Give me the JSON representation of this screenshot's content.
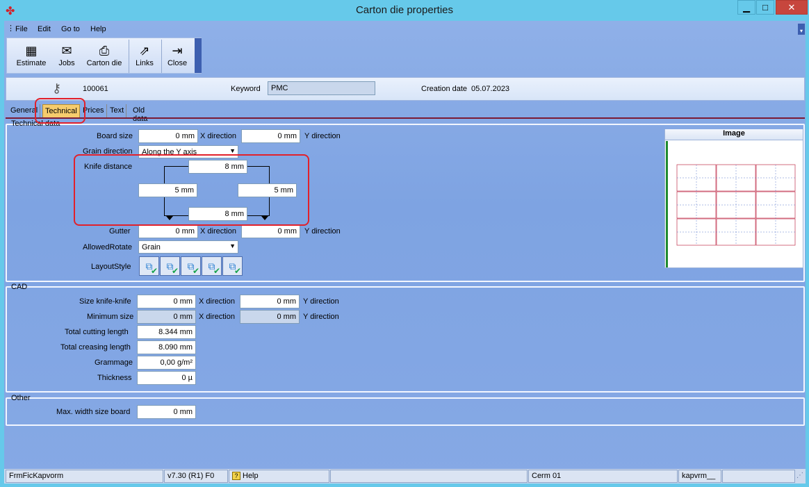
{
  "window": {
    "title": "Carton die properties",
    "minimize_glyph": "▁",
    "maximize_glyph": "□",
    "close_glyph": "✕"
  },
  "menu": {
    "items": [
      "File",
      "Edit",
      "Go to",
      "Help"
    ]
  },
  "toolbar": {
    "estimate": "Estimate",
    "jobs": "Jobs",
    "carton_die": "Carton die",
    "links": "Links",
    "close": "Close"
  },
  "header": {
    "id": "100061",
    "keyword_label": "Keyword",
    "keyword_value": "PMC",
    "creation_date_label": "Creation date",
    "creation_date_value": "05.07.2023"
  },
  "tabs": [
    "General",
    "Technical",
    "Prices",
    "Text",
    "Old data"
  ],
  "technical": {
    "section_title": "Technical data",
    "board_size_label": "Board size",
    "board_size_x": "0 mm",
    "x_direction": "X direction",
    "board_size_y": "0 mm",
    "y_direction": "Y direction",
    "grain_direction_label": "Grain direction",
    "grain_direction_value": "Along the Y axis",
    "knife_distance_label": "Knife distance",
    "knife_top": "8 mm",
    "knife_left": "5 mm",
    "knife_right": "5 mm",
    "knife_bottom": "8 mm",
    "gutter_label": "Gutter",
    "gutter_x": "0 mm",
    "gutter_y": "0 mm",
    "allowed_rotate_label": "AllowedRotate",
    "allowed_rotate_value": "Grain",
    "layout_style_label": "LayoutStyle"
  },
  "image_panel": {
    "title": "Image"
  },
  "cad": {
    "section_title": "CAD",
    "size_knife_label": "Size knife-knife",
    "size_knife_x": "0 mm",
    "size_knife_y": "0 mm",
    "minimum_size_label": "Minimum size",
    "minimum_size_x": "0 mm",
    "minimum_size_y": "0 mm",
    "x_direction": "X direction",
    "y_direction": "Y direction",
    "total_cutting_label": "Total cutting length",
    "total_cutting_value": "8.344 mm",
    "total_creasing_label": "Total creasing length",
    "total_creasing_value": "8.090 mm",
    "grammage_label": "Grammage",
    "grammage_value": "0,00 g/m²",
    "thickness_label": "Thickness",
    "thickness_value": "0 µ"
  },
  "other": {
    "section_title": "Other",
    "max_width_label": "Max. width size board",
    "max_width_value": "0 mm"
  },
  "status": {
    "form": "FrmFicKapvorm",
    "version": "v7.30 (R1) F0",
    "help": "Help",
    "company": "Cerm 01",
    "user": "kapvrm__"
  },
  "colors": {
    "accent": "#66c9ea",
    "highlight": "#e2202a",
    "active_tab": "#f6cc6d"
  }
}
